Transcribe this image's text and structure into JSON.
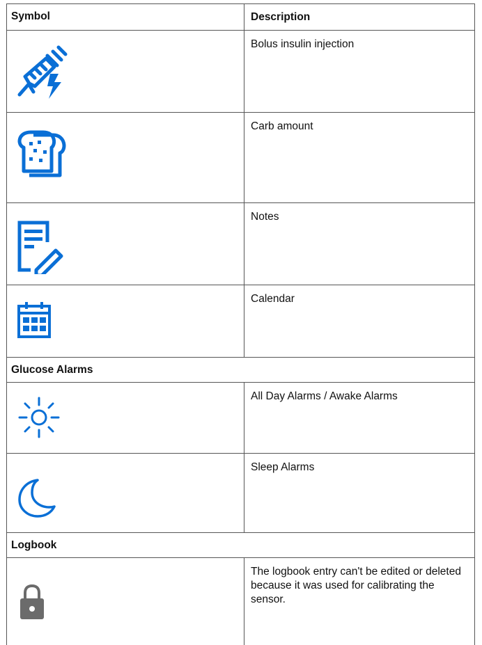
{
  "table": {
    "header": {
      "symbol": "Symbol",
      "description": "Description"
    },
    "rows": [
      {
        "icon": "syringe-bolus-icon",
        "description": "Bolus insulin injection"
      },
      {
        "icon": "bread-carb-icon",
        "description": "Carb amount"
      },
      {
        "icon": "notes-pencil-icon",
        "description": "Notes"
      },
      {
        "icon": "calendar-icon",
        "description": "Calendar"
      }
    ],
    "sections": [
      {
        "title": "Glucose Alarms",
        "rows": [
          {
            "icon": "sun-icon",
            "description": "All Day Alarms / Awake Alarms"
          },
          {
            "icon": "moon-icon",
            "description": "Sleep Alarms"
          }
        ]
      },
      {
        "title": "Logbook",
        "rows": [
          {
            "icon": "lock-icon",
            "description": "The logbook entry can't be edited or deleted because it was used for calibrating the sensor."
          }
        ]
      }
    ]
  },
  "colors": {
    "icon_blue": "#0a6fd6",
    "lock_gray": "#6b6b6b",
    "border": "#555555"
  }
}
